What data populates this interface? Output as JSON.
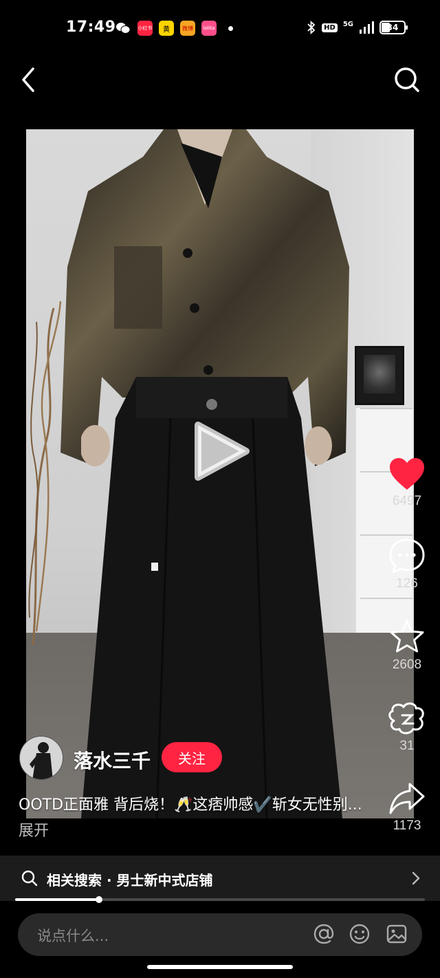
{
  "status_bar": {
    "time": "17:49",
    "notif_badges": [
      "小红书",
      "黄",
      "微博",
      "lolita"
    ],
    "network": "5G",
    "battery": "34"
  },
  "nav": {
    "back_icon": "chevron-left-icon",
    "search_icon": "search-icon"
  },
  "video": {
    "playing": false
  },
  "actions": {
    "like_count": "6497",
    "comment_count": "126",
    "collect_count": "2608",
    "unknown_count": "31",
    "share_count": "1173",
    "like_color": "#ff2442"
  },
  "author": {
    "name": "落水三千",
    "follow_label": "关注"
  },
  "caption": {
    "text": "OOTD正面雅 背后烧！🥂这痞帅感✔️斩女无性别... ",
    "expand_label": "展开"
  },
  "related_search": {
    "label": "相关搜索 · 男士新中式店铺"
  },
  "progress": {
    "fraction": 0.205
  },
  "comment_box": {
    "placeholder": "说点什么..."
  }
}
